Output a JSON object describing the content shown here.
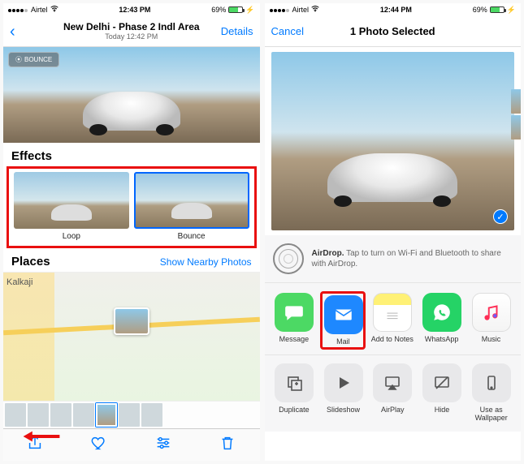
{
  "left": {
    "status": {
      "carrier": "Airtel",
      "time": "12:43 PM",
      "battery": "69%"
    },
    "nav": {
      "title": "New Delhi - Phase 2 Indl Area",
      "subtitle": "Today 12:42 PM",
      "details": "Details"
    },
    "badge": "BOUNCE",
    "effects_header": "Effects",
    "effects": [
      {
        "label": "Loop"
      },
      {
        "label": "Bounce"
      }
    ],
    "places_header": "Places",
    "nearby_link": "Show Nearby Photos",
    "map_area_label": "Kalkaji"
  },
  "right": {
    "status": {
      "carrier": "Airtel",
      "time": "12:44 PM",
      "battery": "69%"
    },
    "nav": {
      "cancel": "Cancel",
      "title": "1 Photo Selected"
    },
    "airdrop": {
      "bold": "AirDrop.",
      "text": " Tap to turn on Wi-Fi and Bluetooth to share with AirDrop."
    },
    "apps": [
      {
        "label": "Message"
      },
      {
        "label": "Mail"
      },
      {
        "label": "Add to Notes"
      },
      {
        "label": "WhatsApp"
      },
      {
        "label": "Music"
      }
    ],
    "actions": [
      {
        "label": "Duplicate"
      },
      {
        "label": "Slideshow"
      },
      {
        "label": "AirPlay"
      },
      {
        "label": "Hide"
      },
      {
        "label": "Use as Wallpaper"
      }
    ]
  }
}
